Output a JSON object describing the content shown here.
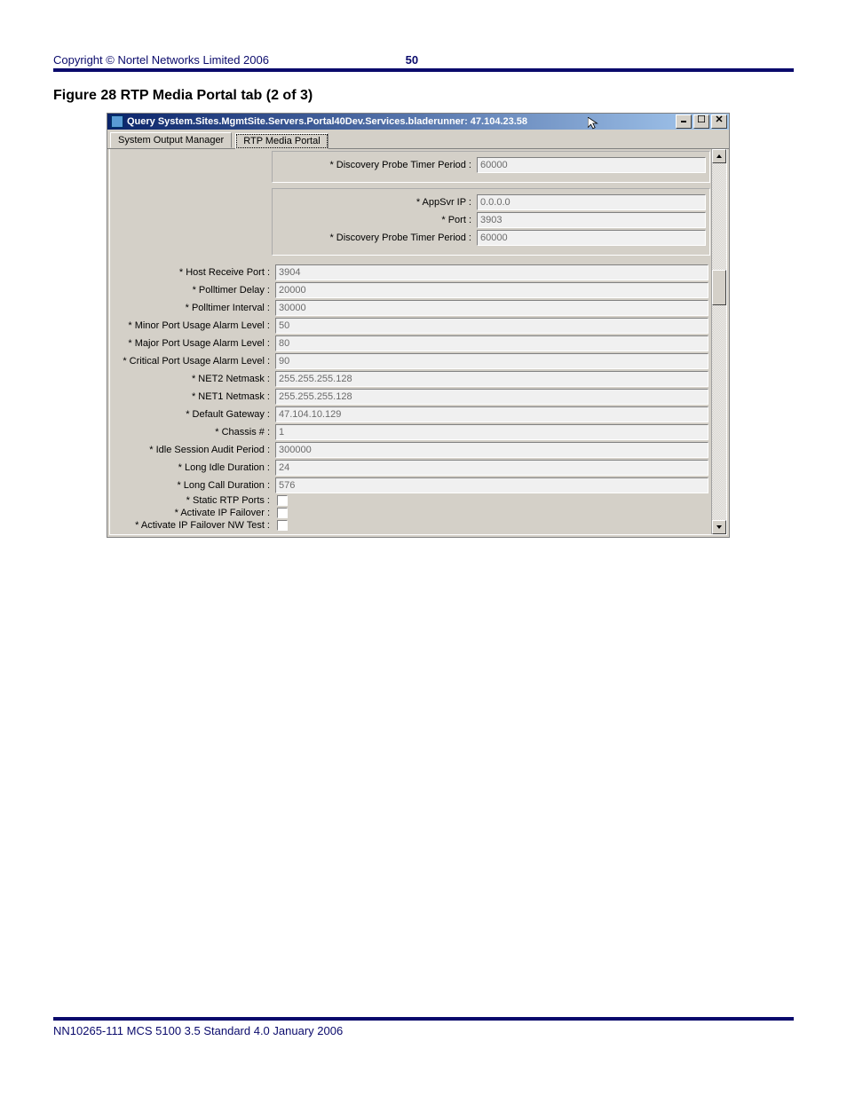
{
  "header": {
    "copyright": "Copyright © Nortel Networks Limited 2006",
    "page_number": "50"
  },
  "figure_caption": "Figure 28  RTP Media Portal tab (2 of 3)",
  "window": {
    "title": "Query System.Sites.MgmtSite.Servers.Portal40Dev.Services.bladerunner: 47.104.23.58",
    "tabs": [
      {
        "label": "System Output Manager",
        "active": false
      },
      {
        "label": "RTP Media Portal",
        "active": true
      }
    ],
    "top_group_a": [
      {
        "label": "* Discovery Probe Timer Period :",
        "value": "60000"
      }
    ],
    "top_group_b": [
      {
        "label": "* AppSvr IP :",
        "value": "0.0.0.0"
      },
      {
        "label": "* Port :",
        "value": "3903"
      },
      {
        "label": "* Discovery Probe Timer Period :",
        "value": "60000"
      }
    ],
    "main_fields": [
      {
        "label": "* Host Receive Port :",
        "value": "3904"
      },
      {
        "label": "* Polltimer Delay :",
        "value": "20000"
      },
      {
        "label": "* Polltimer Interval :",
        "value": "30000"
      },
      {
        "label": "* Minor Port Usage Alarm Level :",
        "value": "50"
      },
      {
        "label": "* Major Port Usage Alarm Level :",
        "value": "80"
      },
      {
        "label": "* Critical Port Usage Alarm Level :",
        "value": "90"
      },
      {
        "label": "* NET2 Netmask :",
        "value": "255.255.255.128"
      },
      {
        "label": "* NET1 Netmask :",
        "value": "255.255.255.128"
      },
      {
        "label": "* Default Gateway :",
        "value": "47.104.10.129"
      },
      {
        "label": "* Chassis # :",
        "value": "1"
      },
      {
        "label": "* Idle Session Audit Period :",
        "value": "300000"
      },
      {
        "label": "* Long Idle Duration :",
        "value": "24"
      },
      {
        "label": "* Long Call Duration :",
        "value": "576"
      }
    ],
    "check_fields": [
      {
        "label": "* Static RTP Ports :"
      },
      {
        "label": "* Activate IP Failover :"
      },
      {
        "label": "* Activate IP Failover NW Test :"
      }
    ]
  },
  "footer": "NN10265-111   MCS 5100 3.5   Standard   4.0   January 2006"
}
